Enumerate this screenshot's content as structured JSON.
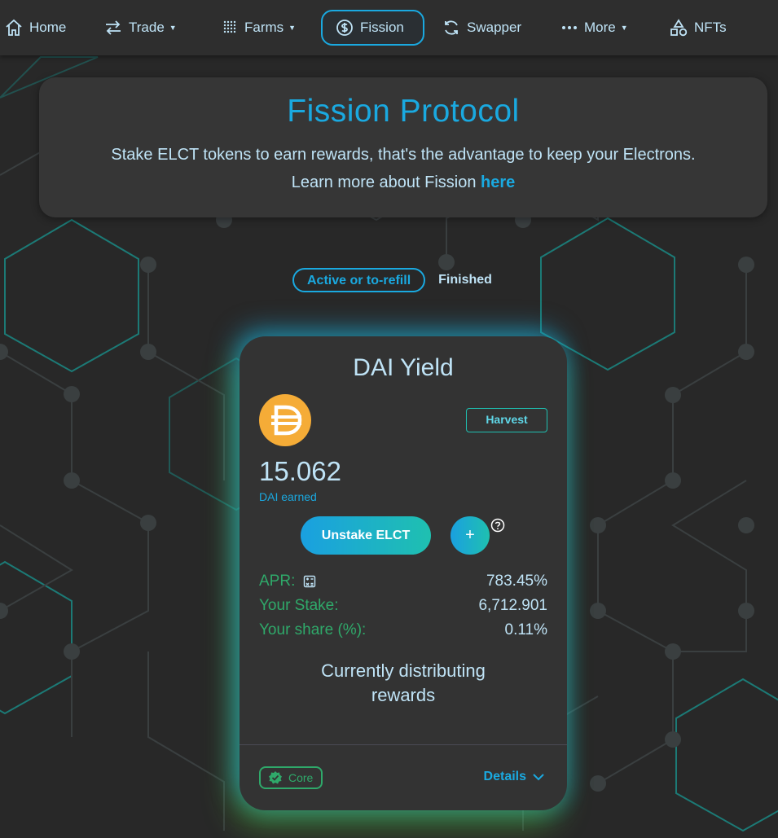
{
  "nav": {
    "items": [
      {
        "label": "Home",
        "icon": "home-icon"
      },
      {
        "label": "Trade",
        "icon": "swap-arrows-icon",
        "dropdown": true
      },
      {
        "label": "Farms",
        "icon": "grid-dots-icon",
        "dropdown": true
      },
      {
        "label": "Fission",
        "icon": "dollar-coin-icon",
        "active": true
      },
      {
        "label": "Swapper",
        "icon": "refresh-icon"
      },
      {
        "label": "More",
        "icon": "more-dots-icon",
        "dropdown": true
      },
      {
        "label": "NFTs",
        "icon": "shapes-icon"
      }
    ]
  },
  "header": {
    "title": "Fission Protocol",
    "subtitle": "Stake ELCT tokens to earn rewards, that's the advantage to keep your Electrons.",
    "learn_more_prefix": "Learn more about Fission ",
    "learn_more_link": "here"
  },
  "tabs": {
    "active": "Active or to-refill",
    "inactive": "Finished"
  },
  "card": {
    "title": "DAI Yield",
    "token_icon": "dai-coin-icon",
    "harvest_label": "Harvest",
    "earned_value": "15.062",
    "earned_label": "DAI earned",
    "unstake_label": "Unstake ELCT",
    "plus_label": "+",
    "apr_label": "APR:",
    "apr_value": "783.45%",
    "stake_label": "Your Stake:",
    "stake_value": "6,712.901",
    "share_label": "Your share (%):",
    "share_value": "0.11%",
    "distributing_line1": "Currently distributing",
    "distributing_line2": "rewards",
    "core_label": "Core",
    "details_label": "Details"
  },
  "colors": {
    "accent_blue": "#1aa9e0",
    "accent_green": "#2fa96a",
    "teal_line": "#1fbfb0",
    "dai_orange": "#f5ac37",
    "background": "#282828",
    "card": "#333333"
  }
}
